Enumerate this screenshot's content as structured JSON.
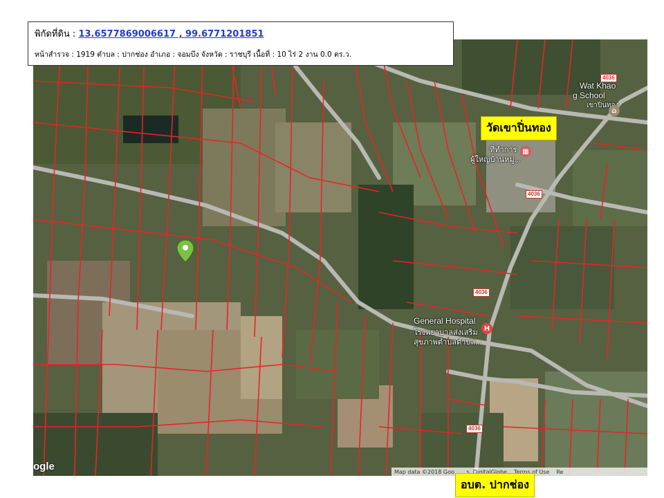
{
  "header": {
    "coord_label": "พิกัดที่ดิน  :",
    "coord_value": "13.6577869006617   ,        99.6771201851",
    "survey_line": "หน้าสำรวจ : 1919 ตำบล : ปากช่อง อำเภอ : จอมบึง  จังหวัด : ราชบุรี   เนื้อที่ : 10 ไร่ 2 งาน 0.0 ตร.ว."
  },
  "labels": {
    "temple": "วัดเขาปิ่นทอง",
    "sao": "อบต. ปากช่อง"
  },
  "map": {
    "poi": {
      "school": "Wat Khao",
      "school2": "g School",
      "school_th": "เขาปิ่นทอง",
      "village_head": "ที่ทำการ",
      "village_head2": "ผู้ใหญ่บ้านหมู่...",
      "hospital": "General Hospital",
      "hospital_th": "โรงพยาบาลส่งเสริม",
      "hospital_th2": "สุขภาพตำบลตำบล..."
    },
    "road_shields": [
      "4036",
      "4036",
      "4036",
      "4036"
    ],
    "colors": {
      "parcel_line": "#e8232a",
      "road": "#b9b9b3",
      "marker": "#7cc242"
    },
    "icons": [
      "location-pin-icon",
      "school-icon",
      "government-building-icon",
      "hospital-icon"
    ]
  },
  "footer": {
    "google_logo": "ogle",
    "attribution": {
      "map_data": "Map data ©2018 Goo",
      "imagery": "...s, DigitalGlobe",
      "terms": "Terms of Use",
      "report": "Re"
    }
  }
}
